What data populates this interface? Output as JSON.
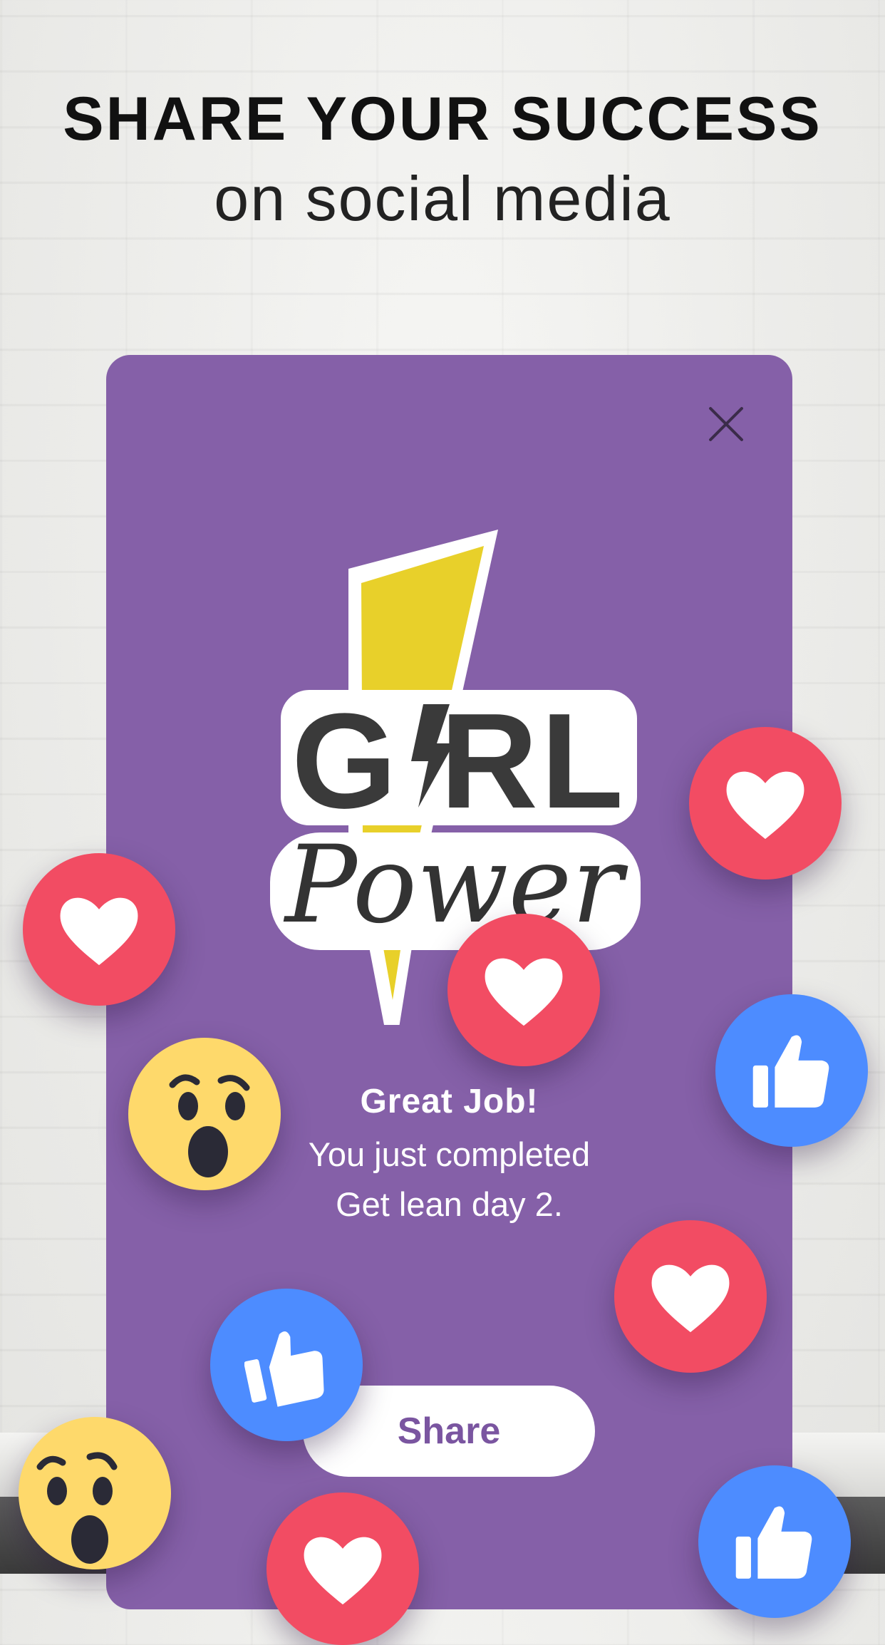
{
  "header": {
    "headline": "SHARE YOUR SUCCESS",
    "subline": "on social media"
  },
  "sticker": {
    "word1": "G RL",
    "word2": "Power"
  },
  "message": {
    "title": "Great Job!",
    "line1": "You just completed",
    "line2": "Get lean day 2."
  },
  "buttons": {
    "share_label": "Share"
  },
  "icons": {
    "close": "close-icon",
    "heart": "heart-icon",
    "like": "thumbs-up-icon",
    "wow": "wow-emoji-icon",
    "bolt": "lightning-bolt-icon"
  },
  "colors": {
    "card": "#8560a8",
    "heart_bubble": "#f24c63",
    "like_bubble": "#4d8cff",
    "wow_emoji": "#fed96b",
    "bolt": "#e8d02a",
    "share_text": "#7a55a0"
  }
}
